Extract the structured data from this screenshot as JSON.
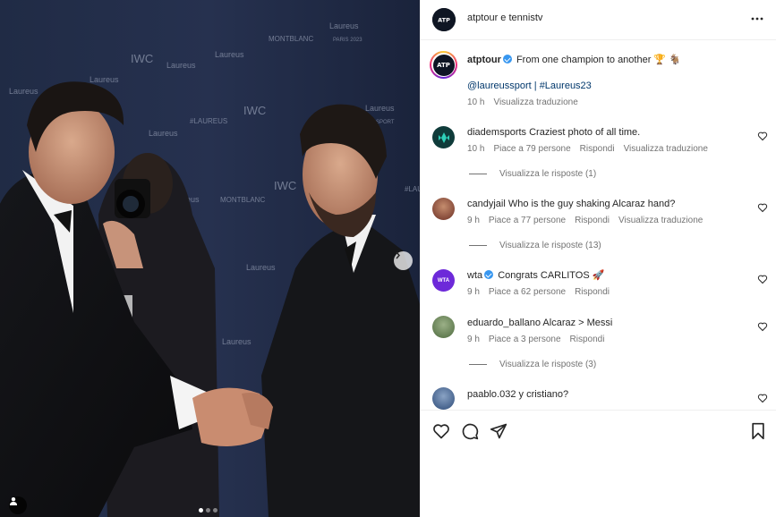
{
  "header": {
    "title": "atptour e tennistv"
  },
  "caption": {
    "username": "atptour",
    "text": "From one champion to another 🏆 🐐",
    "mentions": "@laureussport",
    "separator": " | ",
    "hashtag": "#Laureus23",
    "time": "10 h",
    "translate": "Visualizza traduzione",
    "avatar_text": "ATP"
  },
  "comments": [
    {
      "username": "diademsports",
      "text": "Craziest photo of all time.",
      "time": "10 h",
      "likes": "Piace a 79 persone",
      "reply": "Rispondi",
      "translate": "Visualizza traduzione",
      "view_replies": "Visualizza le risposte (1)",
      "avatar_color": "#0f3b3a"
    },
    {
      "username": "candyjail",
      "text": "Who is the guy shaking Alcaraz hand?",
      "time": "9 h",
      "likes": "Piace a 77 persone",
      "reply": "Rispondi",
      "translate": "Visualizza traduzione",
      "view_replies": "Visualizza le risposte (13)",
      "avatar_color": "#7a3a2e"
    },
    {
      "username": "wta",
      "text": "Congrats CARLITOS 🚀",
      "time": "9 h",
      "likes": "Piace a 62 persone",
      "reply": "Rispondi",
      "avatar_color": "#6d29d9",
      "avatar_text": "WTA"
    },
    {
      "username": "eduardo_ballano",
      "text": "Alcaraz > Messi",
      "time": "9 h",
      "likes": "Piace a 3 persone",
      "reply": "Rispondi",
      "view_replies": "Visualizza le risposte (3)",
      "avatar_color": "#6f8a5a"
    },
    {
      "username": "paablo.032",
      "text": "y cristiano?",
      "avatar_color": "#3a5c8a"
    }
  ],
  "photo": {
    "backdrop_texts": [
      "Laureus",
      "IWC",
      "MONTBLANC",
      "#LAUREUS",
      "PARIS 2023"
    ],
    "carousel_dots": 3,
    "active_dot": 0
  },
  "colors": {
    "link": "#00376b",
    "verified": "#3897f0",
    "muted": "#737373"
  }
}
